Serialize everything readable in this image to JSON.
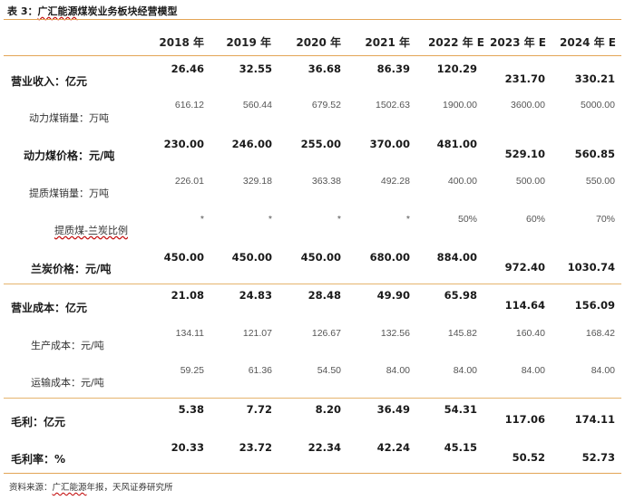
{
  "title": {
    "prefix": "表 3：",
    "name": "广汇能源",
    "suffix": "煤炭业务板块经营模型"
  },
  "years": [
    "2018 年",
    "2019 年",
    "2020 年",
    "2021 年",
    "2022 年 E",
    "2023 年 E",
    "2024 年 E"
  ],
  "rows": [
    {
      "label": "营业收入：亿元",
      "values": [
        "26.46",
        "32.55",
        "36.68",
        "86.39",
        "120.29",
        "231.70",
        "330.21"
      ]
    },
    {
      "label": "动力煤销量：万吨",
      "values": [
        "616.12",
        "560.44",
        "679.52",
        "1502.63",
        "1900.00",
        "3600.00",
        "5000.00"
      ]
    },
    {
      "label": "动力煤价格：元/吨",
      "values": [
        "230.00",
        "246.00",
        "255.00",
        "370.00",
        "481.00",
        "529.10",
        "560.85"
      ]
    },
    {
      "label": "提质煤销量：万吨",
      "values": [
        "226.01",
        "329.18",
        "363.38",
        "492.28",
        "400.00",
        "500.00",
        "550.00"
      ]
    },
    {
      "label": "提质煤-兰炭比例",
      "values": [
        "*",
        "*",
        "*",
        "*",
        "50%",
        "60%",
        "70%"
      ]
    },
    {
      "label": "兰炭价格：元/吨",
      "values": [
        "450.00",
        "450.00",
        "450.00",
        "680.00",
        "884.00",
        "972.40",
        "1030.74"
      ]
    },
    {
      "label": "营业成本：亿元",
      "values": [
        "21.08",
        "24.83",
        "28.48",
        "49.90",
        "65.98",
        "114.64",
        "156.09"
      ]
    },
    {
      "label": "生产成本：元/吨",
      "values": [
        "134.11",
        "121.07",
        "126.67",
        "132.56",
        "145.82",
        "160.40",
        "168.42"
      ]
    },
    {
      "label": "运输成本：元/吨",
      "values": [
        "59.25",
        "61.36",
        "54.50",
        "84.00",
        "84.00",
        "84.00",
        "84.00"
      ]
    },
    {
      "label": "毛利：亿元",
      "values": [
        "5.38",
        "7.72",
        "8.20",
        "36.49",
        "54.31",
        "117.06",
        "174.11"
      ]
    },
    {
      "label": "毛利率：%",
      "values": [
        "20.33",
        "23.72",
        "22.34",
        "42.24",
        "45.15",
        "50.52",
        "52.73"
      ]
    }
  ],
  "source": {
    "prefix": "资料来源：",
    "name": "广汇能源",
    "suffix": "年报，天风证券研究所"
  }
}
